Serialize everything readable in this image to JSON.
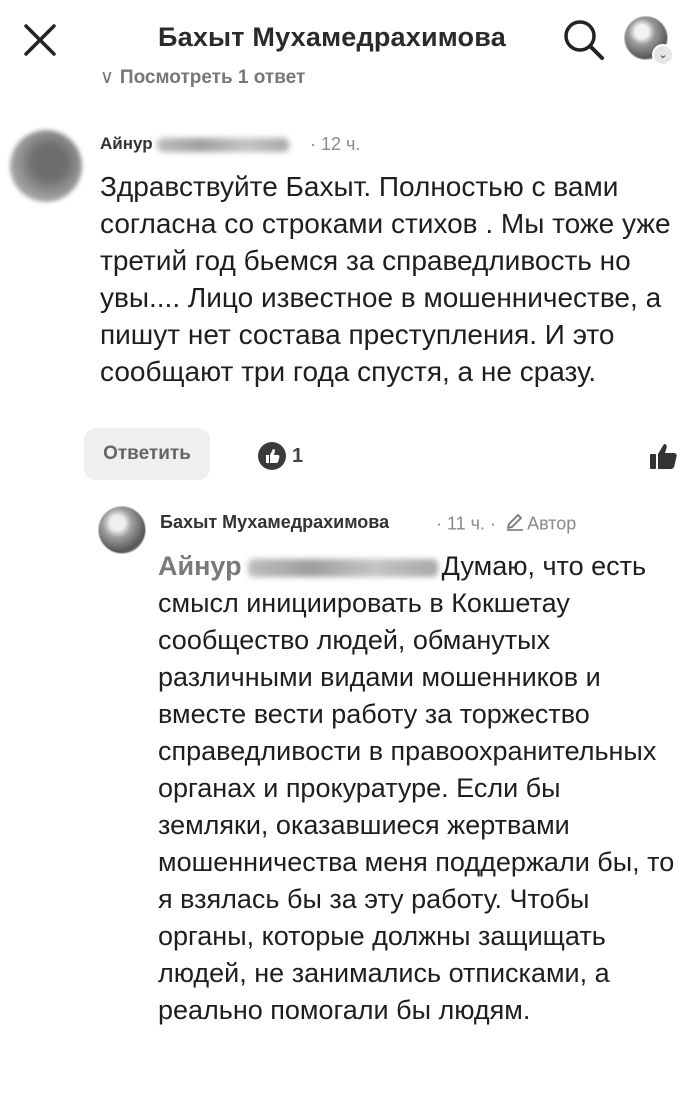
{
  "header": {
    "title": "Бахыт Мухамедрахимова",
    "close_icon": "close-icon",
    "search_icon": "search-icon",
    "profile_icon": "chevron-down-icon"
  },
  "thread": {
    "view_replies_label": "Посмотреть 1 ответ"
  },
  "comment": {
    "author_first": "Айнур",
    "time": "· 12 ч.",
    "text": "Здравствуйте Бахыт. Полностью с вами согласна со строками стихов . Мы тоже уже третий год бьемся за справедливость но увы.... Лицо известное в мошенничестве, а пишут нет состава преступления. И это сообщают три года спустя, а не сразу.",
    "reply_label": "Ответить",
    "reaction_count": "1",
    "like_icon": "thumbs-up-icon"
  },
  "reply": {
    "author": "Бахыт Мухамедрахимова",
    "time": "· 11 ч. ·",
    "author_badge": "Автор",
    "mention_first": "Айнур",
    "text_rest": "Думаю, что есть смысл инициировать в Кокшетау сообщество людей, обманутых различными видами мошенников и вместе вести работу за торжество справедливости в правоохранительных органах и прокуратуре. Если бы земляки, оказавшиеся жертвами мошенничества меня поддержали бы, то я взялась бы за эту работу. Чтобы органы, которые должны защищать людей, не занимались отписками, а реально помогали бы людям."
  },
  "colors": {
    "text": "#1e1e1e",
    "muted": "#8a8a8a",
    "button_bg": "#efefef"
  }
}
